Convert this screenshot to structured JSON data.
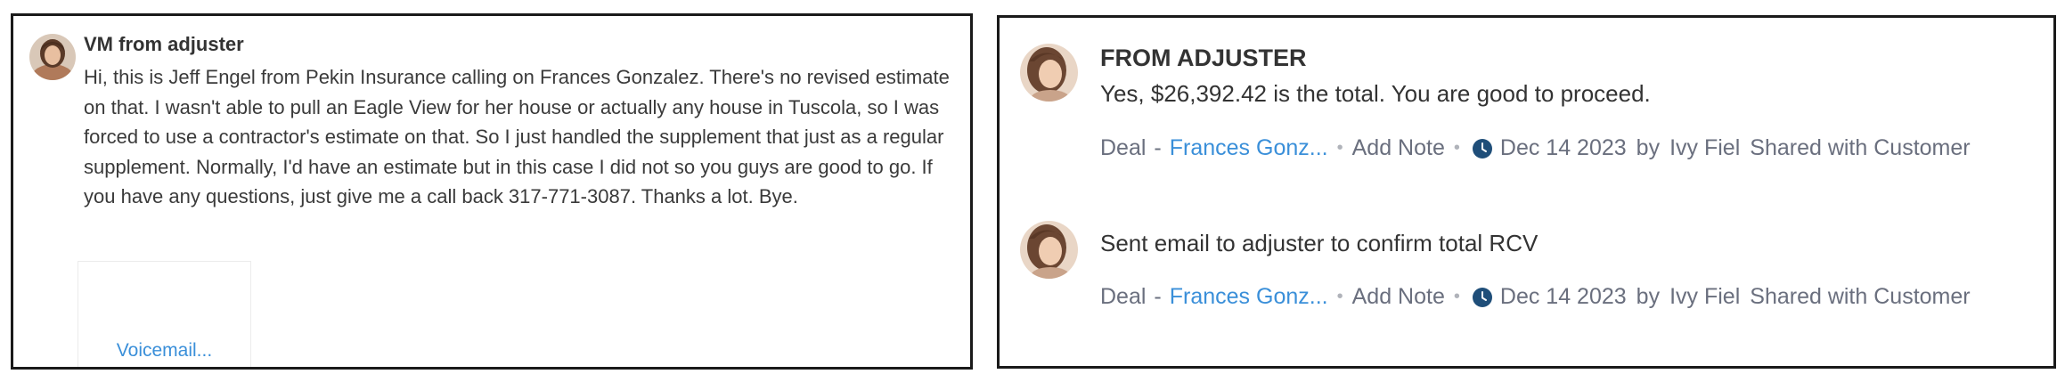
{
  "left": {
    "title": "VM from adjuster",
    "body": "Hi, this is Jeff Engel from Pekin Insurance calling on Frances Gonzalez. There's no revised estimate on that. I wasn't able to pull an Eagle View for her house or actually any house in Tuscola, so I was forced to use a contractor's estimate on that. So I just handled the supplement that just as a regular supplement. Normally, I'd have an estimate but in this case I did not so you guys are good to go. If you have any questions, just give me a call back 317-771-3087. Thanks a lot. Bye.",
    "voicemail_label": "Voicemail..."
  },
  "notes": [
    {
      "title": "FROM ADJUSTER",
      "text": "Yes, $26,392.42 is the total.  You are good to proceed.",
      "module": "Deal",
      "dash": "-",
      "record": "Frances Gonz...",
      "dot": "•",
      "add_note": "Add Note",
      "date": "Dec 14 2023",
      "by": "by",
      "owner": "Ivy Fiel",
      "shared": "Shared with Customer"
    },
    {
      "title": "",
      "text": "Sent email to adjuster to confirm total RCV",
      "module": "Deal",
      "dash": "-",
      "record": "Frances Gonz...",
      "dot": "•",
      "add_note": "Add Note",
      "date": "Dec 14 2023",
      "by": "by",
      "owner": "Ivy Fiel",
      "shared": "Shared with Customer"
    }
  ],
  "colors": {
    "link": "#3a8fd9",
    "meta": "#6a6f7e",
    "clock": "#1f4e79",
    "border": "#1a1a1a"
  },
  "icons": [
    "avatar",
    "clock-icon"
  ]
}
